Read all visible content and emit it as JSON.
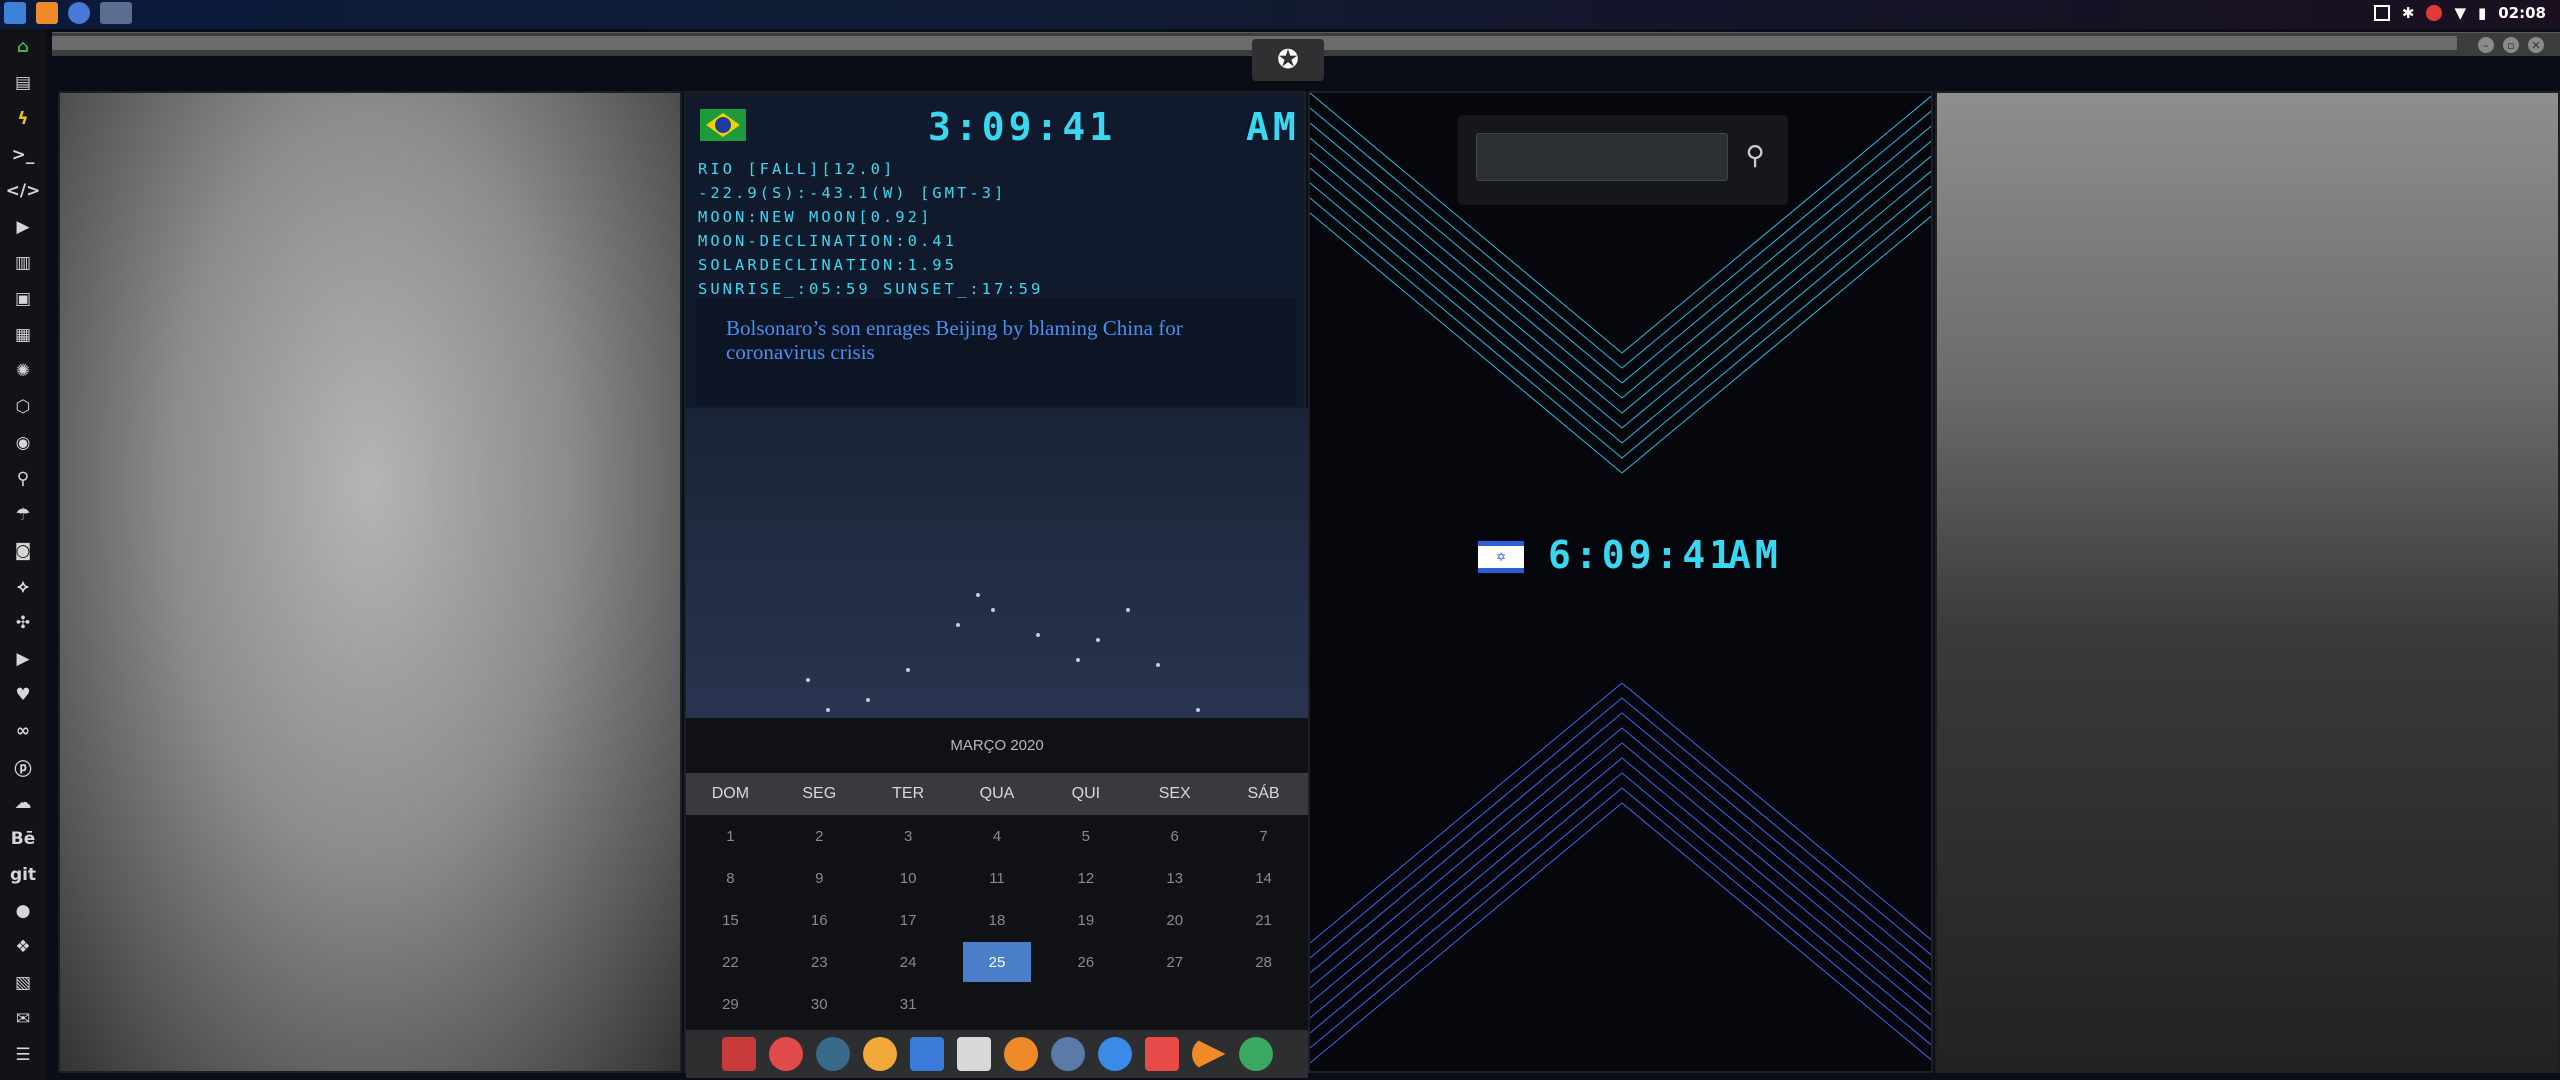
{
  "system": {
    "clock": "02:08"
  },
  "sidebar": {
    "icons": [
      "home-icon",
      "document-icon",
      "bolt-icon",
      "terminal-icon",
      "code-icon",
      "play-icon",
      "files-icon",
      "image-icon",
      "news-icon",
      "settings-icon",
      "hexagon-icon",
      "globe-icon",
      "search-icon",
      "umbrella-icon",
      "contact-icon",
      "connect-icon",
      "expand-icon",
      "youtube-icon",
      "heart-icon",
      "infinity-icon",
      "pinterest-icon",
      "cloud-icon",
      "behance-icon",
      "git-icon",
      "github-icon",
      "dropbox-icon",
      "map-icon",
      "mail-icon",
      "storage-icon"
    ],
    "behance": "Bē",
    "git": "git"
  },
  "clock_brazil": {
    "time": "3:09:41",
    "ampm": "AM",
    "lines": [
      "RIO [FALL][12.0]",
      "-22.9(S):-43.1(W) [GMT-3]",
      "MOON:NEW MOON[0.92]",
      "MOON-DECLINATION:0.41",
      "SOLARDECLINATION:1.95",
      "SUNRISE_:05:59 SUNSET_:17:59"
    ]
  },
  "news": {
    "headline": "Bolsonaro’s son enrages Beijing by blaming China for coronavirus crisis"
  },
  "calendar": {
    "title": "MARÇO 2020",
    "days": [
      "DOM",
      "SEG",
      "TER",
      "QUA",
      "QUI",
      "SEX",
      "SÁB"
    ],
    "dates": [
      "1",
      "2",
      "3",
      "4",
      "5",
      "6",
      "7",
      "8",
      "9",
      "10",
      "11",
      "12",
      "13",
      "14",
      "15",
      "16",
      "17",
      "18",
      "19",
      "20",
      "21",
      "22",
      "23",
      "24",
      "25",
      "26",
      "27",
      "28",
      "29",
      "30",
      "31"
    ],
    "today": "25"
  },
  "search": {
    "placeholder": ""
  },
  "clock_israel": {
    "time": "6:09:41",
    "ampm": "AM"
  }
}
